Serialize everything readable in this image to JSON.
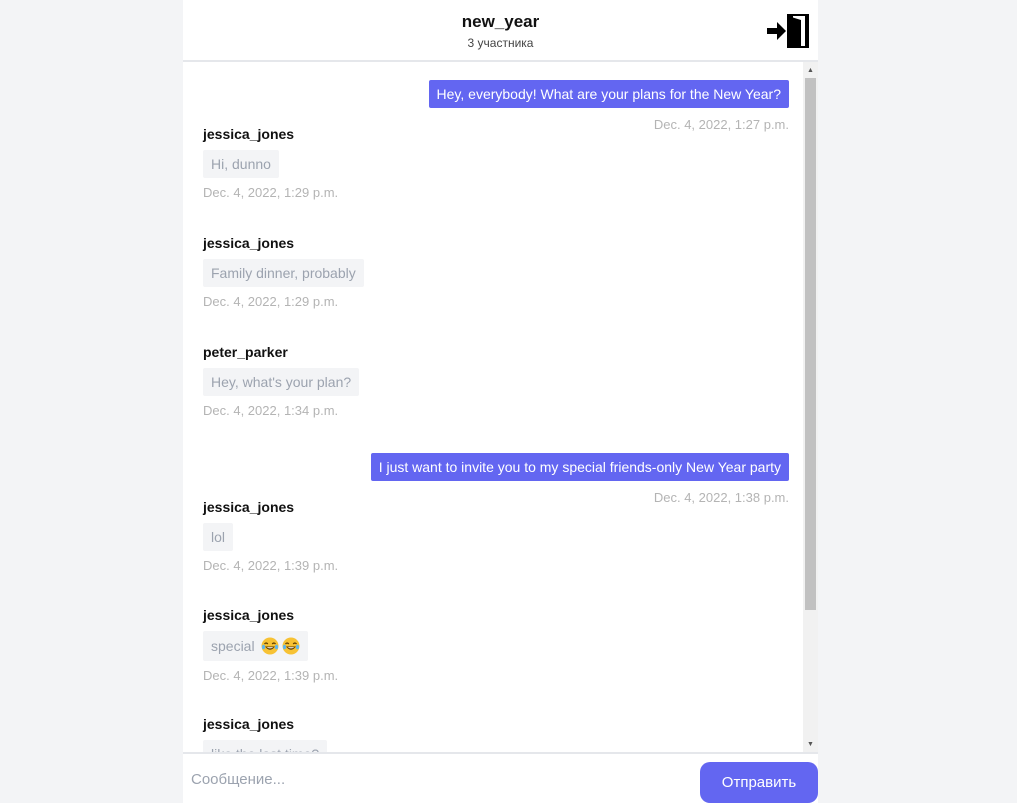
{
  "header": {
    "title": "new_year",
    "subtitle": "3 участника",
    "exit_icon": "exit-door-icon"
  },
  "messages": [
    {
      "direction": "out",
      "text": "Hey, everybody! What are your plans for the New Year?",
      "time": "Dec. 4, 2022, 1:27 p.m."
    },
    {
      "direction": "in",
      "author": "jessica_jones",
      "text": "Hi, dunno",
      "time": "Dec. 4, 2022, 1:29 p.m."
    },
    {
      "direction": "in",
      "author": "jessica_jones",
      "text": "Family dinner, probably",
      "time": "Dec. 4, 2022, 1:29 p.m."
    },
    {
      "direction": "in",
      "author": "peter_parker",
      "text": "Hey, what's your plan?",
      "time": "Dec. 4, 2022, 1:34 p.m."
    },
    {
      "direction": "out",
      "text": "I just want to invite you to my special friends-only New Year party",
      "time": "Dec. 4, 2022, 1:38 p.m."
    },
    {
      "direction": "in",
      "author": "jessica_jones",
      "text": "lol",
      "time": "Dec. 4, 2022, 1:39 p.m."
    },
    {
      "direction": "in",
      "author": "jessica_jones",
      "text": "special",
      "emoji": [
        "laughing-tears-emoji",
        "laughing-tears-emoji"
      ],
      "time": "Dec. 4, 2022, 1:39 p.m."
    },
    {
      "direction": "in",
      "author": "jessica_jones",
      "text": "like the last time?",
      "time": ""
    }
  ],
  "composer": {
    "placeholder": "Сообщение...",
    "send_label": "Отправить"
  },
  "colors": {
    "accent": "#6366f1",
    "incoming_bubble": "#f3f4f6",
    "timestamp": "#b4b4b4"
  }
}
